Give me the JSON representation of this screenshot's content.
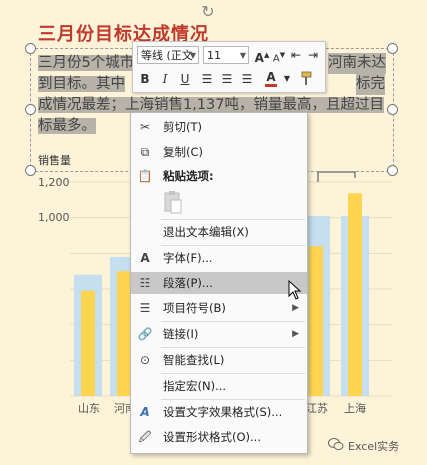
{
  "title": "三月份目标达成情况",
  "paragraph": {
    "text": "三月份5个城市的销售量中，其中杭州、河南未达到目标。其中，上海销售1,137吨，销量最高，且超过目标最多。",
    "lines": [
      "三月份5个城市",
      "到目标。其中",
      "成情况最差；上海销售1,137吨，销量最高，且超过目",
      "标最多。"
    ],
    "right_fragments": [
      "河南未达",
      "标完"
    ]
  },
  "chart": {
    "ylabel": "销售量",
    "yticks": [
      "1,200",
      "1,000"
    ],
    "xticks": [
      "山东",
      "河南",
      "江苏",
      "上海"
    ]
  },
  "chart_data": {
    "type": "bar",
    "categories": [
      "山东",
      "河南",
      "",
      "",
      "江苏",
      "上海"
    ],
    "series": [
      {
        "values": [
          680,
          780,
          0,
          0,
          1010,
          1010
        ]
      },
      {
        "values": [
          590,
          700,
          0,
          0,
          840,
          1137
        ]
      }
    ],
    "ylabel": "销售量",
    "ylim": [
      0,
      1200
    ]
  },
  "toolbar": {
    "font_name": "等线 (正文",
    "font_size": "11",
    "icons": {
      "grow_font": "A^",
      "shrink_font": "A^",
      "decrease_indent": "≡",
      "increase_indent": "≡",
      "bold": "B",
      "italic": "I",
      "underline": "U",
      "align_left": "≡",
      "align_center": "≡",
      "align_right": "≡",
      "font_color": "A",
      "format_painter": "🖌"
    },
    "font_color": "#c0392b"
  },
  "context_menu": {
    "items": [
      {
        "label": "剪切(T)",
        "icon": "scissors-icon"
      },
      {
        "label": "复制(C)",
        "icon": "copy-icon"
      },
      {
        "label": "粘贴选项:",
        "icon": "clipboard-icon"
      },
      {
        "label": "退出文本编辑(X)",
        "icon": ""
      },
      {
        "label": "字体(F)...",
        "icon": "font-icon"
      },
      {
        "label": "段落(P)...",
        "icon": "paragraph-icon"
      },
      {
        "label": "项目符号(B)",
        "icon": "bullets-icon",
        "submenu": true
      },
      {
        "label": "链接(I)",
        "icon": "link-icon",
        "submenu": true
      },
      {
        "label": "智能查找(L)",
        "icon": "smart-lookup-icon"
      },
      {
        "label": "指定宏(N)...",
        "icon": ""
      },
      {
        "label": "设置文字效果格式(S)...",
        "icon": "text-effects-icon"
      },
      {
        "label": "设置形状格式(O)...",
        "icon": "shape-format-icon"
      }
    ],
    "hovered": "段落(P)..."
  },
  "watermark": "Excel实务",
  "colors": {
    "background": "#fdf3d8",
    "title": "#c0392b",
    "bar_light": "#c5dff0",
    "bar_yellow": "#ffd54f",
    "selection": "#b7b3a8"
  }
}
